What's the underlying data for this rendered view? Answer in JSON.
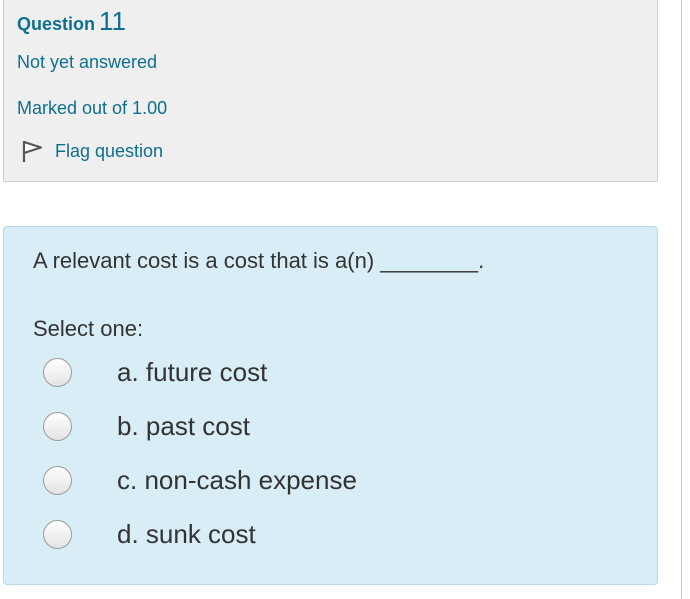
{
  "question_info": {
    "question_word": "Question",
    "question_number": "11",
    "state": "Not yet answered",
    "grade": "Marked out of 1.00",
    "flag_label": "Flag question"
  },
  "question": {
    "text": "A relevant cost is a cost that is a(n) ________.",
    "prompt": "Select one:",
    "options": [
      {
        "label": "a. future cost"
      },
      {
        "label": "b. past cost"
      },
      {
        "label": "c. non-cash expense"
      },
      {
        "label": "d. sunk cost"
      }
    ]
  },
  "colors": {
    "link": "#0f6f8f",
    "info_bg": "#efefef",
    "content_bg": "#d8edf5"
  }
}
